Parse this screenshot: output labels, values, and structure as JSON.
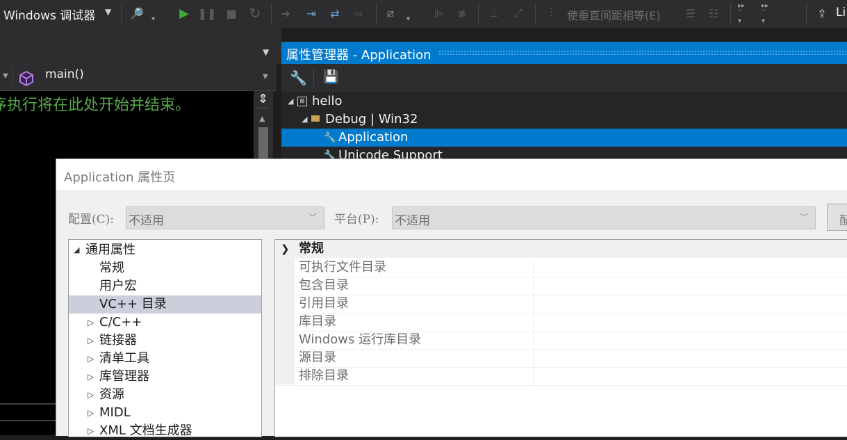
{
  "toolbar": {
    "config_dropdown": "Windows 调试器",
    "make_spacing_equal": "使垂直间距相等(E)",
    "right_truncated": "Li"
  },
  "editor": {
    "function_dropdown": "main()",
    "code_comment": "序执行将在此处开始并结束。"
  },
  "property_manager": {
    "title": "属性管理器 - Application",
    "tree": [
      {
        "label": "hello",
        "level": 0
      },
      {
        "label": "Debug | Win32",
        "level": 1
      },
      {
        "label": "Application",
        "level": 2
      },
      {
        "label": "Unicode Support",
        "level": 2
      }
    ]
  },
  "dialog": {
    "title": "Application 属性页",
    "config_label": "配置(C):",
    "config_value": "不适用",
    "platform_label": "平台(P):",
    "platform_value": "不适用",
    "config_manager_button": "配",
    "nav": [
      {
        "label": "通用属性",
        "expanded": true,
        "level": 0
      },
      {
        "label": "常规",
        "level": 1
      },
      {
        "label": "用户宏",
        "level": 1
      },
      {
        "label": "VC++ 目录",
        "level": 1,
        "selected": true
      },
      {
        "label": "C/C++",
        "level": 1,
        "collapsed": true
      },
      {
        "label": "链接器",
        "level": 1,
        "collapsed": true
      },
      {
        "label": "清单工具",
        "level": 1,
        "collapsed": true
      },
      {
        "label": "库管理器",
        "level": 1,
        "collapsed": true
      },
      {
        "label": "资源",
        "level": 1,
        "collapsed": true
      },
      {
        "label": "MIDL",
        "level": 1,
        "collapsed": true
      },
      {
        "label": "XML 文档生成器",
        "level": 1,
        "collapsed": true
      }
    ],
    "grid": {
      "category": "常规",
      "rows": [
        "可执行文件目录",
        "包含目录",
        "引用目录",
        "库目录",
        "Windows 运行库目录",
        "源目录",
        "排除目录"
      ]
    }
  },
  "colors": {
    "accent": "#007acc",
    "selection": "#007acc",
    "nav_selected": "#cccedb",
    "comment": "#57a64a"
  }
}
